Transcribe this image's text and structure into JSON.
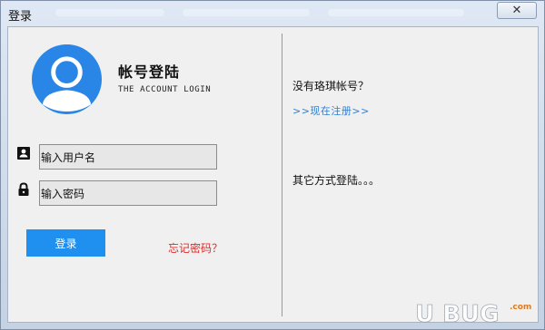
{
  "window": {
    "title": "登录",
    "close_glyph": "✕"
  },
  "login": {
    "heading": "帐号登陆",
    "subheading": "THE ACCOUNT LOGIN",
    "username_placeholder": "输入用户名",
    "password_placeholder": "输入密码",
    "login_button": "登录",
    "forgot_link": "忘记密码？"
  },
  "side": {
    "no_account": "没有珞琪帐号？",
    "register_link": ">>现在注册>>",
    "other_methods": "其它方式登陆。。。"
  },
  "icons": {
    "avatar": "user-avatar-icon",
    "user_field": "contact-card-icon",
    "password_field": "lock-icon",
    "close": "close-icon"
  },
  "colors": {
    "avatar_blue": "#2a86e6",
    "login_button": "#1f90f0",
    "forgot_link": "#e22a2a",
    "register_link": "#2d7fd4"
  },
  "watermark": {
    "logo_text": "U BUG",
    "domain": ".com"
  }
}
